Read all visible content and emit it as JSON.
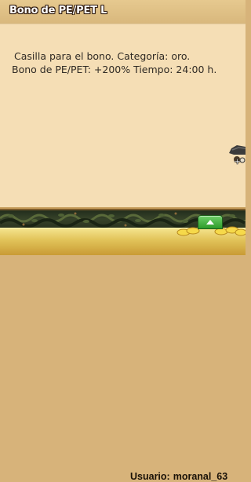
{
  "window": {
    "title": "Bono de PE/PET L"
  },
  "bonus": {
    "line1": "Casilla para el bono. Categoría: oro.",
    "line2": "Bono de PE/PET: +200% Tiempo: 24:00 h."
  },
  "footer": {
    "user_prefix": "Usuario:",
    "username": "moranal_63"
  },
  "colors": {
    "panel_bg": "#f5deb5",
    "header_bg": "#d8b77c",
    "toggle_green": "#2e9b2a",
    "footer_gold": "#e2c45a"
  },
  "icons": {
    "toggle": "chevron-up-icon",
    "sprite": "character-sprite"
  }
}
